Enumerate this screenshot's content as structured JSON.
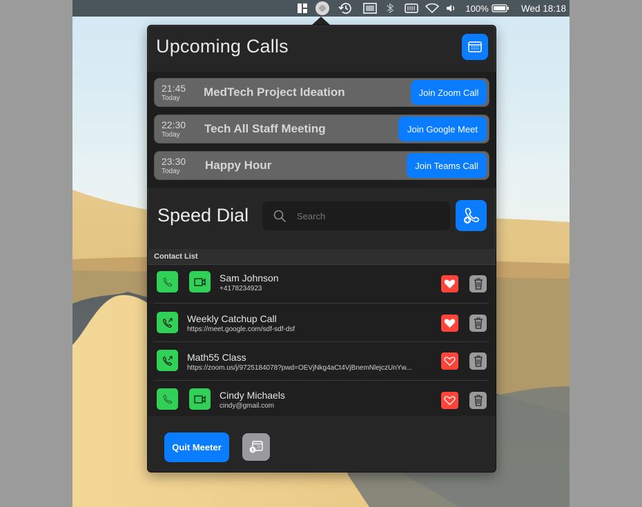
{
  "menubar": {
    "items": [
      {
        "icon": "window-layout-icon"
      },
      {
        "icon": "meeter-waveform-icon"
      },
      {
        "icon": "time-machine-icon"
      },
      {
        "icon": "display-mirror-icon"
      },
      {
        "icon": "bluetooth-icon"
      },
      {
        "icon": "memory-icon"
      },
      {
        "icon": "wifi-icon"
      },
      {
        "icon": "volume-icon"
      }
    ],
    "battery_percent": "100%",
    "battery_level": 100,
    "clock": "Wed 18:18"
  },
  "upcoming": {
    "title": "Upcoming Calls",
    "calendar_button_icon": "calendar-icon",
    "calls": [
      {
        "time": "21:45",
        "day": "Today",
        "title": "MedTech Project Ideation",
        "join_label": "Join Zoom Call"
      },
      {
        "time": "22:30",
        "day": "Today",
        "title": "Tech All Staff Meeting",
        "join_label": "Join Google Meet"
      },
      {
        "time": "23:30",
        "day": "Today",
        "title": "Happy Hour",
        "join_label": "Join Teams Call"
      }
    ]
  },
  "speed_dial": {
    "title": "Speed Dial",
    "search_placeholder": "Search",
    "search_value": "",
    "add_button_icon": "add-contact-icon",
    "list_header": "Contact List",
    "contacts": [
      {
        "name": "Sam Johnson",
        "detail": "+4178234923",
        "type": "phone",
        "video": true,
        "favorite": true
      },
      {
        "name": "Weekly Catchup Call",
        "detail": "https://meet.google.com/sdf-sdf-dsf",
        "type": "link",
        "video": false,
        "favorite": true
      },
      {
        "name": "Math55 Class",
        "detail": "https://zoom.us/j/9725184078?pwd=OEVjNkg4aCt4VjBnemNlejczUnYw...",
        "type": "link",
        "video": false,
        "favorite": false
      },
      {
        "name": "Cindy Michaels",
        "detail": "cindy@gmail.com",
        "type": "phone",
        "video": true,
        "favorite": false
      }
    ]
  },
  "footer": {
    "quit_label": "Quit Meeter",
    "settings_button_icon": "calendar-settings-icon"
  },
  "colors": {
    "accent_blue": "#0a7cff",
    "call_green": "#31d158",
    "favorite_red": "#ff453a",
    "neutral_gray": "#9a9a9e"
  }
}
